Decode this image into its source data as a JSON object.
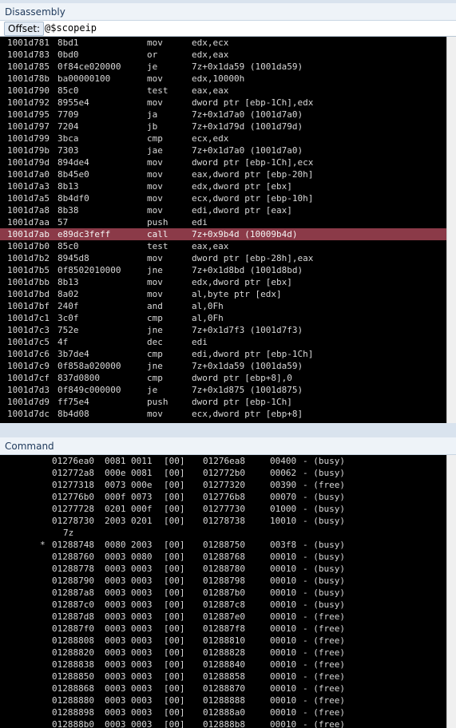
{
  "disassembly": {
    "title": "Disassembly",
    "offset_label": "Offset:",
    "offset_value": "@$scopeip",
    "lines": [
      {
        "addr": "1001d781",
        "bytes": "8bd1",
        "mnemonic": "mov",
        "operands": "edx,ecx"
      },
      {
        "addr": "1001d783",
        "bytes": "0bd0",
        "mnemonic": "or",
        "operands": "edx,eax"
      },
      {
        "addr": "1001d785",
        "bytes": "0f84ce020000",
        "mnemonic": "je",
        "operands": "7z+0x1da59 (1001da59)"
      },
      {
        "addr": "1001d78b",
        "bytes": "ba00000100",
        "mnemonic": "mov",
        "operands": "edx,10000h"
      },
      {
        "addr": "1001d790",
        "bytes": "85c0",
        "mnemonic": "test",
        "operands": "eax,eax"
      },
      {
        "addr": "1001d792",
        "bytes": "8955e4",
        "mnemonic": "mov",
        "operands": "dword ptr [ebp-1Ch],edx"
      },
      {
        "addr": "1001d795",
        "bytes": "7709",
        "mnemonic": "ja",
        "operands": "7z+0x1d7a0 (1001d7a0)"
      },
      {
        "addr": "1001d797",
        "bytes": "7204",
        "mnemonic": "jb",
        "operands": "7z+0x1d79d (1001d79d)"
      },
      {
        "addr": "1001d799",
        "bytes": "3bca",
        "mnemonic": "cmp",
        "operands": "ecx,edx"
      },
      {
        "addr": "1001d79b",
        "bytes": "7303",
        "mnemonic": "jae",
        "operands": "7z+0x1d7a0 (1001d7a0)"
      },
      {
        "addr": "1001d79d",
        "bytes": "894de4",
        "mnemonic": "mov",
        "operands": "dword ptr [ebp-1Ch],ecx"
      },
      {
        "addr": "1001d7a0",
        "bytes": "8b45e0",
        "mnemonic": "mov",
        "operands": "eax,dword ptr [ebp-20h]"
      },
      {
        "addr": "1001d7a3",
        "bytes": "8b13",
        "mnemonic": "mov",
        "operands": "edx,dword ptr [ebx]"
      },
      {
        "addr": "1001d7a5",
        "bytes": "8b4df0",
        "mnemonic": "mov",
        "operands": "ecx,dword ptr [ebp-10h]"
      },
      {
        "addr": "1001d7a8",
        "bytes": "8b38",
        "mnemonic": "mov",
        "operands": "edi,dword ptr [eax]"
      },
      {
        "addr": "1001d7aa",
        "bytes": "57",
        "mnemonic": "push",
        "operands": "edi"
      },
      {
        "addr": "1001d7ab",
        "bytes": "e89dc3feff",
        "mnemonic": "call",
        "operands": "7z+0x9b4d (10009b4d)",
        "highlighted": true
      },
      {
        "addr": "1001d7b0",
        "bytes": "85c0",
        "mnemonic": "test",
        "operands": "eax,eax"
      },
      {
        "addr": "1001d7b2",
        "bytes": "8945d8",
        "mnemonic": "mov",
        "operands": "dword ptr [ebp-28h],eax"
      },
      {
        "addr": "1001d7b5",
        "bytes": "0f8502010000",
        "mnemonic": "jne",
        "operands": "7z+0x1d8bd (1001d8bd)"
      },
      {
        "addr": "1001d7bb",
        "bytes": "8b13",
        "mnemonic": "mov",
        "operands": "edx,dword ptr [ebx]"
      },
      {
        "addr": "1001d7bd",
        "bytes": "8a02",
        "mnemonic": "mov",
        "operands": "al,byte ptr [edx]"
      },
      {
        "addr": "1001d7bf",
        "bytes": "240f",
        "mnemonic": "and",
        "operands": "al,0Fh"
      },
      {
        "addr": "1001d7c1",
        "bytes": "3c0f",
        "mnemonic": "cmp",
        "operands": "al,0Fh"
      },
      {
        "addr": "1001d7c3",
        "bytes": "752e",
        "mnemonic": "jne",
        "operands": "7z+0x1d7f3 (1001d7f3)"
      },
      {
        "addr": "1001d7c5",
        "bytes": "4f",
        "mnemonic": "dec",
        "operands": "edi"
      },
      {
        "addr": "1001d7c6",
        "bytes": "3b7de4",
        "mnemonic": "cmp",
        "operands": "edi,dword ptr [ebp-1Ch]"
      },
      {
        "addr": "1001d7c9",
        "bytes": "0f858a020000",
        "mnemonic": "jne",
        "operands": "7z+0x1da59 (1001da59)"
      },
      {
        "addr": "1001d7cf",
        "bytes": "837d0800",
        "mnemonic": "cmp",
        "operands": "dword ptr [ebp+8],0"
      },
      {
        "addr": "1001d7d3",
        "bytes": "0f849c000000",
        "mnemonic": "je",
        "operands": "7z+0x1d875 (1001d875)"
      },
      {
        "addr": "1001d7d9",
        "bytes": "ff75e4",
        "mnemonic": "push",
        "operands": "dword ptr [ebp-1Ch]"
      },
      {
        "addr": "1001d7dc",
        "bytes": "8b4d08",
        "mnemonic": "mov",
        "operands": "ecx,dword ptr [ebp+8]"
      }
    ]
  },
  "command": {
    "title": "Command",
    "lines": [
      {
        "marker": "",
        "entry": "01276ea0",
        "size": "0081",
        "prev": "0011",
        "flags": "[00]",
        "user": "01276ea8",
        "usize": "00400",
        "state": "- (busy)"
      },
      {
        "marker": "",
        "entry": "012772a8",
        "size": "000e",
        "prev": "0081",
        "flags": "[00]",
        "user": "012772b0",
        "usize": "00062",
        "state": "- (busy)"
      },
      {
        "marker": "",
        "entry": "01277318",
        "size": "0073",
        "prev": "000e",
        "flags": "[00]",
        "user": "01277320",
        "usize": "00390",
        "state": "- (free)"
      },
      {
        "marker": "",
        "entry": "012776b0",
        "size": "000f",
        "prev": "0073",
        "flags": "[00]",
        "user": "012776b8",
        "usize": "00070",
        "state": "- (busy)"
      },
      {
        "marker": "",
        "entry": "01277728",
        "size": "0201",
        "prev": "000f",
        "flags": "[00]",
        "user": "01277730",
        "usize": "01000",
        "state": "- (busy)"
      },
      {
        "marker": "",
        "entry": "01278730",
        "size": "2003",
        "prev": "0201",
        "flags": "[00]",
        "user": "01278738",
        "usize": "10010",
        "state": "- (busy)"
      },
      {
        "wrap": "7z"
      },
      {
        "marker": "*",
        "entry": "01288748",
        "size": "0080",
        "prev": "2003",
        "flags": "[00]",
        "user": "01288750",
        "usize": "003f8",
        "state": "- (busy)"
      },
      {
        "marker": "",
        "entry": "01288760",
        "size": "0003",
        "prev": "0080",
        "flags": "[00]",
        "user": "01288768",
        "usize": "00010",
        "state": "- (busy)"
      },
      {
        "marker": "",
        "entry": "01288778",
        "size": "0003",
        "prev": "0003",
        "flags": "[00]",
        "user": "01288780",
        "usize": "00010",
        "state": "- (busy)"
      },
      {
        "marker": "",
        "entry": "01288790",
        "size": "0003",
        "prev": "0003",
        "flags": "[00]",
        "user": "01288798",
        "usize": "00010",
        "state": "- (busy)"
      },
      {
        "marker": "",
        "entry": "012887a8",
        "size": "0003",
        "prev": "0003",
        "flags": "[00]",
        "user": "012887b0",
        "usize": "00010",
        "state": "- (busy)"
      },
      {
        "marker": "",
        "entry": "012887c0",
        "size": "0003",
        "prev": "0003",
        "flags": "[00]",
        "user": "012887c8",
        "usize": "00010",
        "state": "- (busy)"
      },
      {
        "marker": "",
        "entry": "012887d8",
        "size": "0003",
        "prev": "0003",
        "flags": "[00]",
        "user": "012887e0",
        "usize": "00010",
        "state": "- (free)"
      },
      {
        "marker": "",
        "entry": "012887f0",
        "size": "0003",
        "prev": "0003",
        "flags": "[00]",
        "user": "012887f8",
        "usize": "00010",
        "state": "- (free)"
      },
      {
        "marker": "",
        "entry": "01288808",
        "size": "0003",
        "prev": "0003",
        "flags": "[00]",
        "user": "01288810",
        "usize": "00010",
        "state": "- (free)"
      },
      {
        "marker": "",
        "entry": "01288820",
        "size": "0003",
        "prev": "0003",
        "flags": "[00]",
        "user": "01288828",
        "usize": "00010",
        "state": "- (free)"
      },
      {
        "marker": "",
        "entry": "01288838",
        "size": "0003",
        "prev": "0003",
        "flags": "[00]",
        "user": "01288840",
        "usize": "00010",
        "state": "- (free)"
      },
      {
        "marker": "",
        "entry": "01288850",
        "size": "0003",
        "prev": "0003",
        "flags": "[00]",
        "user": "01288858",
        "usize": "00010",
        "state": "- (free)"
      },
      {
        "marker": "",
        "entry": "01288868",
        "size": "0003",
        "prev": "0003",
        "flags": "[00]",
        "user": "01288870",
        "usize": "00010",
        "state": "- (free)"
      },
      {
        "marker": "",
        "entry": "01288880",
        "size": "0003",
        "prev": "0003",
        "flags": "[00]",
        "user": "01288888",
        "usize": "00010",
        "state": "- (free)"
      },
      {
        "marker": "",
        "entry": "01288898",
        "size": "0003",
        "prev": "0003",
        "flags": "[00]",
        "user": "012888a0",
        "usize": "00010",
        "state": "- (free)"
      },
      {
        "marker": "",
        "entry": "012888b0",
        "size": "0003",
        "prev": "0003",
        "flags": "[00]",
        "user": "012888b8",
        "usize": "00010",
        "state": "- (free)"
      }
    ]
  },
  "colors": {
    "highlight_row": "#8b3a48",
    "console_background": "#000000",
    "console_text": "#d8d8d8",
    "pane_frame": "#d9e3ee"
  }
}
